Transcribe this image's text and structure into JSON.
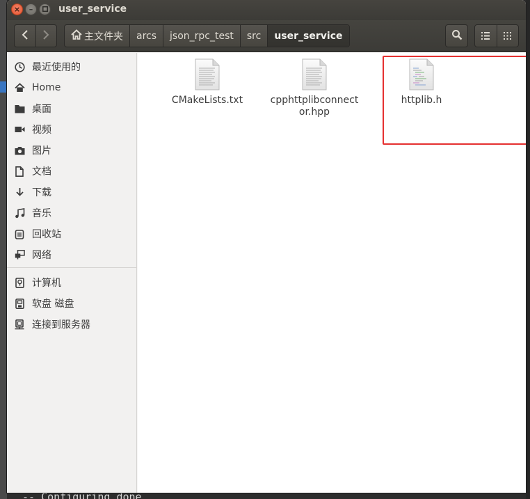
{
  "window": {
    "title": "user_service"
  },
  "toolbar": {
    "back_icon": "chevron-left-icon",
    "forward_icon": "chevron-right-icon",
    "breadcrumbs": [
      {
        "label": "主文件夹",
        "icon": "home-icon"
      },
      {
        "label": "arcs"
      },
      {
        "label": "json_rpc_test"
      },
      {
        "label": "src"
      },
      {
        "label": "user_service",
        "active": true
      }
    ],
    "search_icon": "search-icon",
    "list_view_icon": "list-view-icon",
    "grid_view_icon": "grid-view-icon"
  },
  "sidebar": {
    "items": [
      {
        "label": "最近使用的",
        "icon": "clock-icon"
      },
      {
        "label": "Home",
        "icon": "home-icon"
      },
      {
        "label": "桌面",
        "icon": "folder-icon"
      },
      {
        "label": "视频",
        "icon": "video-icon"
      },
      {
        "label": "图片",
        "icon": "camera-icon"
      },
      {
        "label": "文档",
        "icon": "document-icon"
      },
      {
        "label": "下载",
        "icon": "download-icon"
      },
      {
        "label": "音乐",
        "icon": "music-icon"
      },
      {
        "label": "回收站",
        "icon": "trash-icon"
      },
      {
        "label": "网络",
        "icon": "network-icon"
      },
      {
        "label": "计算机",
        "icon": "computer-icon"
      },
      {
        "label": "软盘 磁盘",
        "icon": "floppy-icon"
      },
      {
        "label": "连接到服务器",
        "icon": "server-icon"
      }
    ]
  },
  "files": [
    {
      "name": "CMakeLists.txt",
      "icon": "text-file-icon"
    },
    {
      "name": "cpphttplibconnector.hpp",
      "icon": "text-file-icon"
    },
    {
      "name": "httplib.h",
      "icon": "source-file-icon"
    }
  ],
  "terminal": {
    "text": "-- Configuring done"
  },
  "colors": {
    "highlight": "#e53030",
    "toolbar": "#3c3b37",
    "close_button": "#e4532e"
  }
}
